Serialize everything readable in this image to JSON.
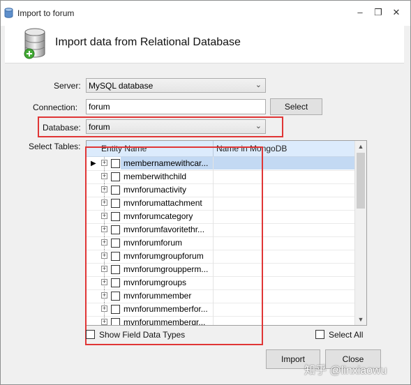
{
  "window": {
    "title": "Import to forum",
    "header_title": "Import data from Relational Database",
    "minimize": "‒",
    "restore": "❐",
    "close": "✕"
  },
  "form": {
    "server_label": "Server:",
    "server_value": "MySQL database",
    "connection_label": "Connection:",
    "connection_value": "forum",
    "select_button": "Select",
    "database_label": "Database:",
    "database_value": "forum",
    "tables_label": "Select Tables:"
  },
  "grid": {
    "col_entity": "Entity Name",
    "col_mongo": "Name in MongoDB",
    "rows": [
      "membernamewithcar...",
      "memberwithchild",
      "mvnforumactivity",
      "mvnforumattachment",
      "mvnforumcategory",
      "mvnforumfavoritethr...",
      "mvnforumforum",
      "mvnforumgroupforum",
      "mvnforumgroupperm...",
      "mvnforumgroups",
      "mvnforummember",
      "mvnforummemberfor...",
      "mvnforummembergr..."
    ]
  },
  "options": {
    "show_field_types": "Show Field Data Types",
    "select_all": "Select All"
  },
  "buttons": {
    "import": "Import",
    "close": "Close"
  },
  "watermark": "知乎 @linxiaowu",
  "colors": {
    "highlight": "#e03535",
    "selection": "#c3d9f3",
    "header_bg": "#dcebfc"
  }
}
